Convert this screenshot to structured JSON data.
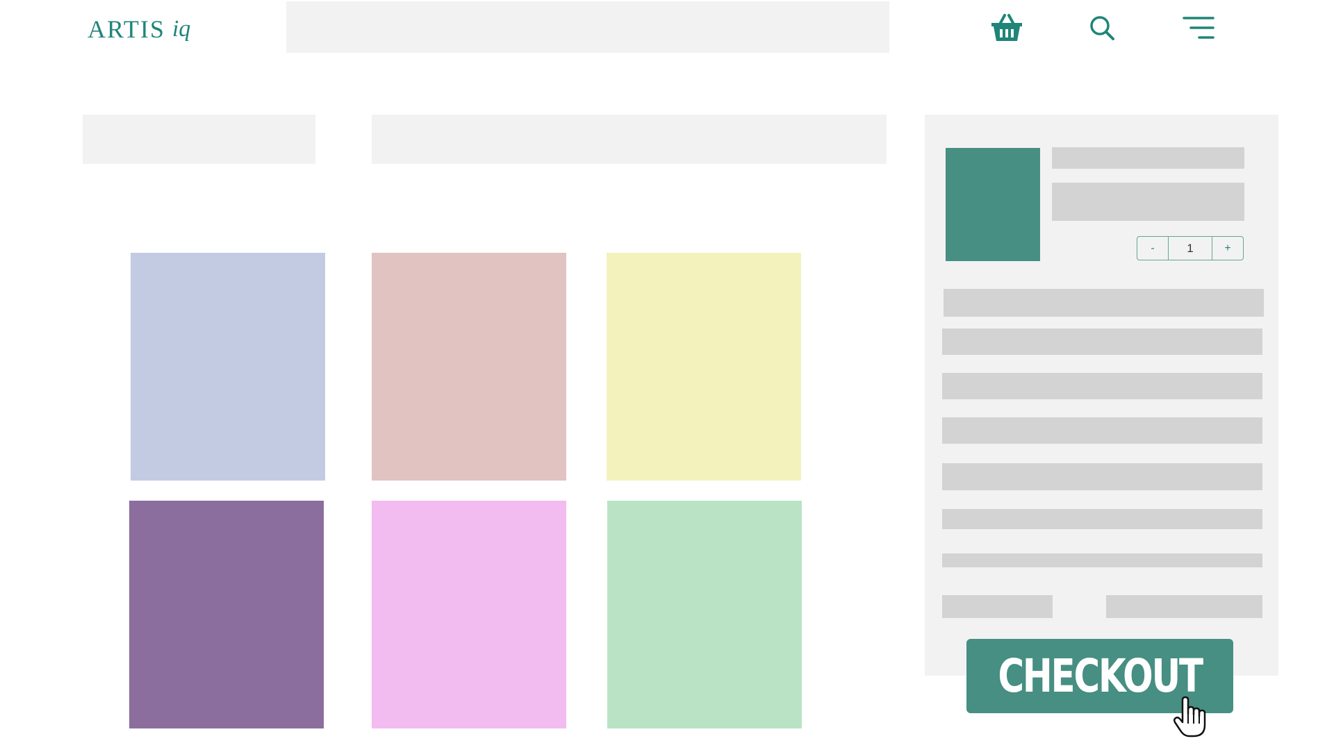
{
  "brand": {
    "logo_main": "ARTIS",
    "logo_sub": "iq"
  },
  "header": {
    "search_placeholder": "",
    "icons": [
      "basket-icon",
      "search-icon",
      "menu-icon"
    ]
  },
  "catalog": {
    "tiles": [
      {
        "color": "#c3cbe3"
      },
      {
        "color": "#e1c3c2"
      },
      {
        "color": "#f3f2bc"
      },
      {
        "color": "#8b6e9d"
      },
      {
        "color": "#f3bcf0"
      },
      {
        "color": "#bae3c6"
      }
    ]
  },
  "cart": {
    "thumb_color": "#468f82",
    "qty_minus": "-",
    "qty_value": "1",
    "qty_plus": "+",
    "checkout_label": "CHECKOUT"
  },
  "colors": {
    "accent": "#1e8577",
    "button": "#468f82",
    "panel": "#f3f2f3",
    "placeholder": "#d3d3d3"
  }
}
